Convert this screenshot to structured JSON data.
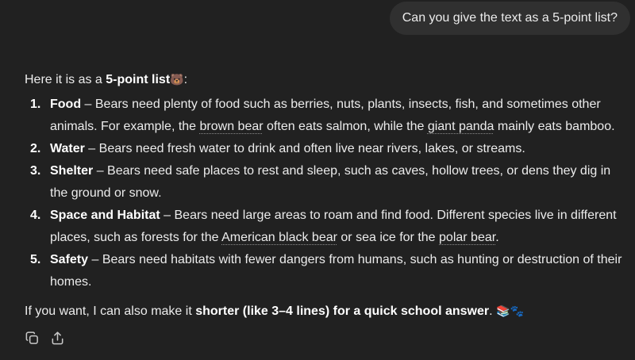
{
  "user_message": "Can you give the text as a 5-point list?",
  "answer": {
    "intro": {
      "prefix": "Here it is as a ",
      "bold": "5-point list",
      "emoji": "🐻",
      "suffix": ":"
    },
    "points": [
      {
        "number": "1.",
        "term": "Food",
        "segments": [
          {
            "text": " – Bears need plenty of food such as berries, nuts, plants, insects, fish, and sometimes other animals. For example, the "
          },
          {
            "text": "brown bear",
            "link": true
          },
          {
            "text": " often eats salmon, while the "
          },
          {
            "text": "giant panda",
            "link": true
          },
          {
            "text": " mainly eats bamboo."
          }
        ]
      },
      {
        "number": "2.",
        "term": "Water",
        "segments": [
          {
            "text": " – Bears need fresh water to drink and often live near rivers, lakes, or streams."
          }
        ]
      },
      {
        "number": "3.",
        "term": "Shelter",
        "segments": [
          {
            "text": " – Bears need safe places to rest and sleep, such as caves, hollow trees, or dens they dig in the ground or snow."
          }
        ]
      },
      {
        "number": "4.",
        "term": "Space and Habitat",
        "segments": [
          {
            "text": " – Bears need large areas to roam and find food. Different species live in different places, such as forests for the "
          },
          {
            "text": "American black bear",
            "link": true
          },
          {
            "text": " or sea ice for the "
          },
          {
            "text": "polar bear",
            "link": true
          },
          {
            "text": "."
          }
        ]
      },
      {
        "number": "5.",
        "term": "Safety",
        "segments": [
          {
            "text": " – Bears need habitats with fewer dangers from humans, such as hunting or destruction of their homes."
          }
        ]
      }
    ],
    "outro": {
      "prefix": "If you want, I can also make it ",
      "bold": "shorter (like 3–4 lines) for a quick school answer",
      "suffix": ".",
      "emoji": "📚🐾"
    }
  },
  "actions": [
    {
      "icon": "copy-icon"
    },
    {
      "icon": "share-icon"
    }
  ]
}
